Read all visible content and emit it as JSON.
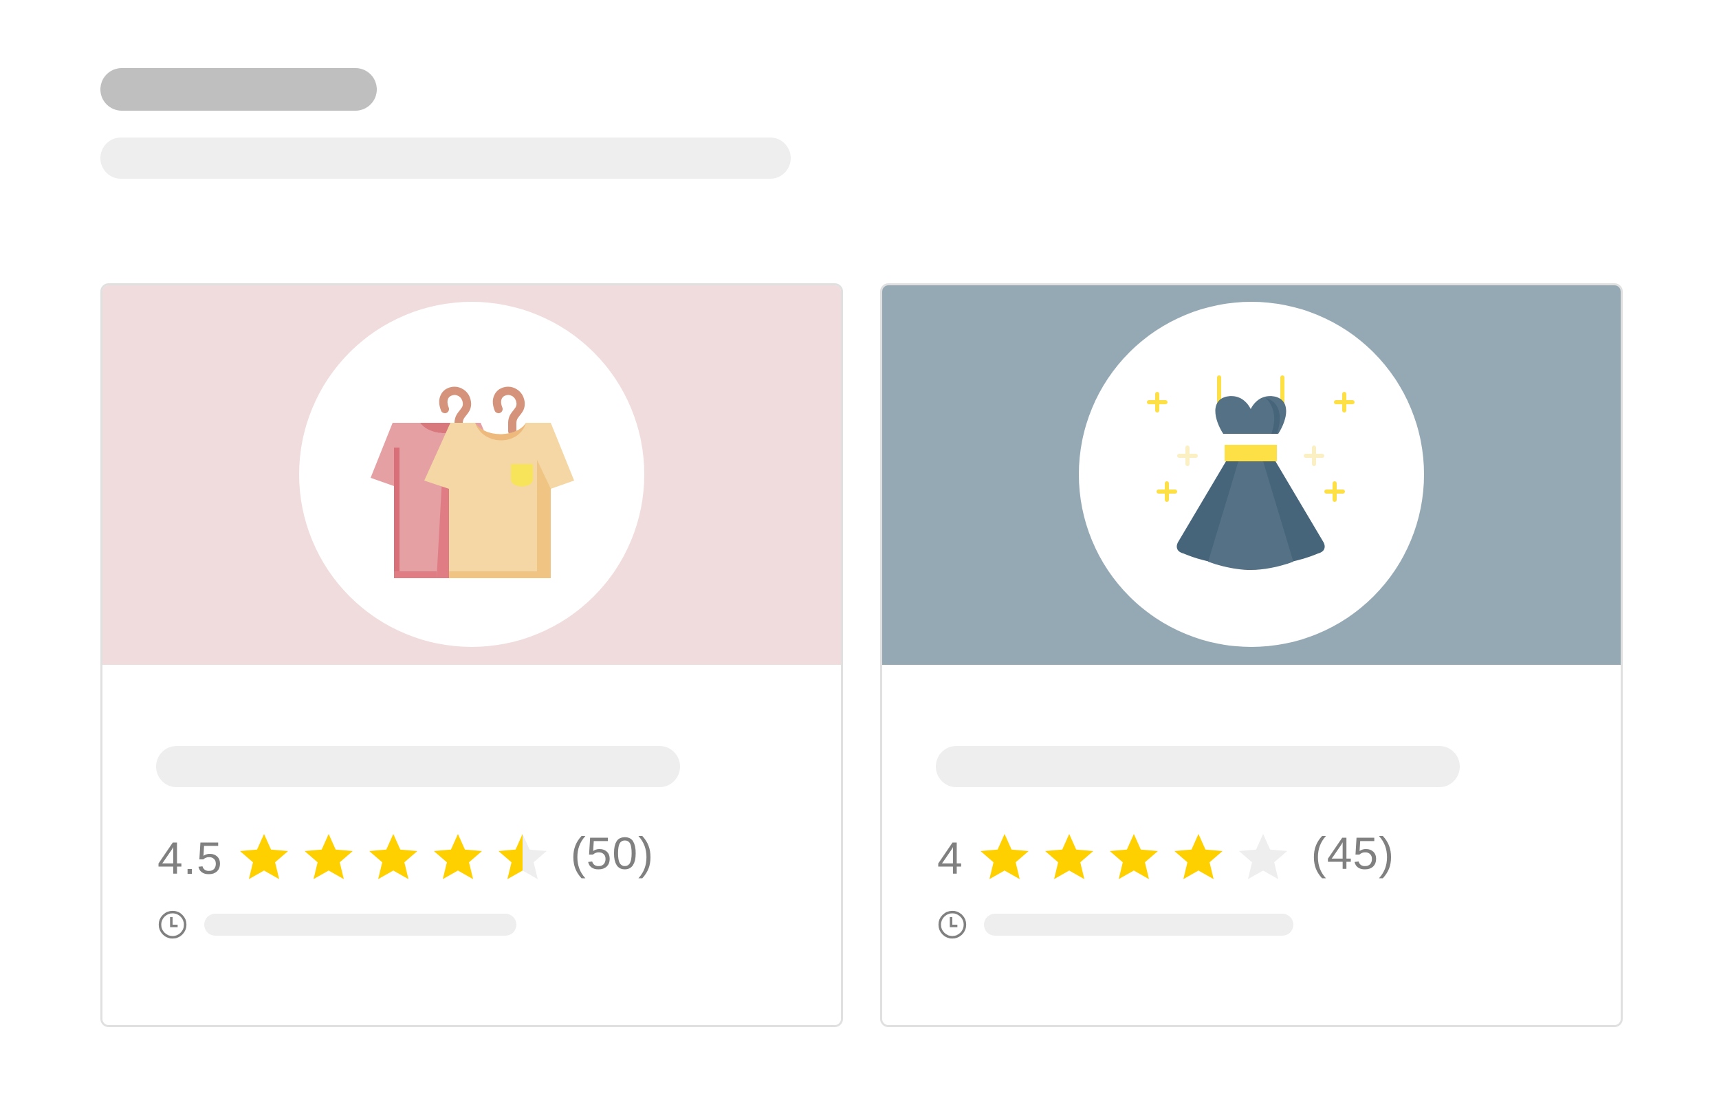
{
  "colors": {
    "skeleton_dark": "#bfbfbf",
    "skeleton_light": "#eeeeee",
    "star_filled": "#ffd000",
    "star_empty": "#eeeeee",
    "text_muted": "#808080",
    "card_border": "#e0e0e0"
  },
  "cards": [
    {
      "banner_color": "#f0dcdd",
      "image_icon": "hanging-shirts-icon",
      "rating": "4.5",
      "rating_value": 4.5,
      "count": "(50)",
      "meta_icon": "clock-icon"
    },
    {
      "banner_color": "#95a9b5",
      "image_icon": "dress-icon",
      "rating": "4",
      "rating_value": 4,
      "count": "(45)",
      "meta_icon": "clock-icon"
    }
  ]
}
